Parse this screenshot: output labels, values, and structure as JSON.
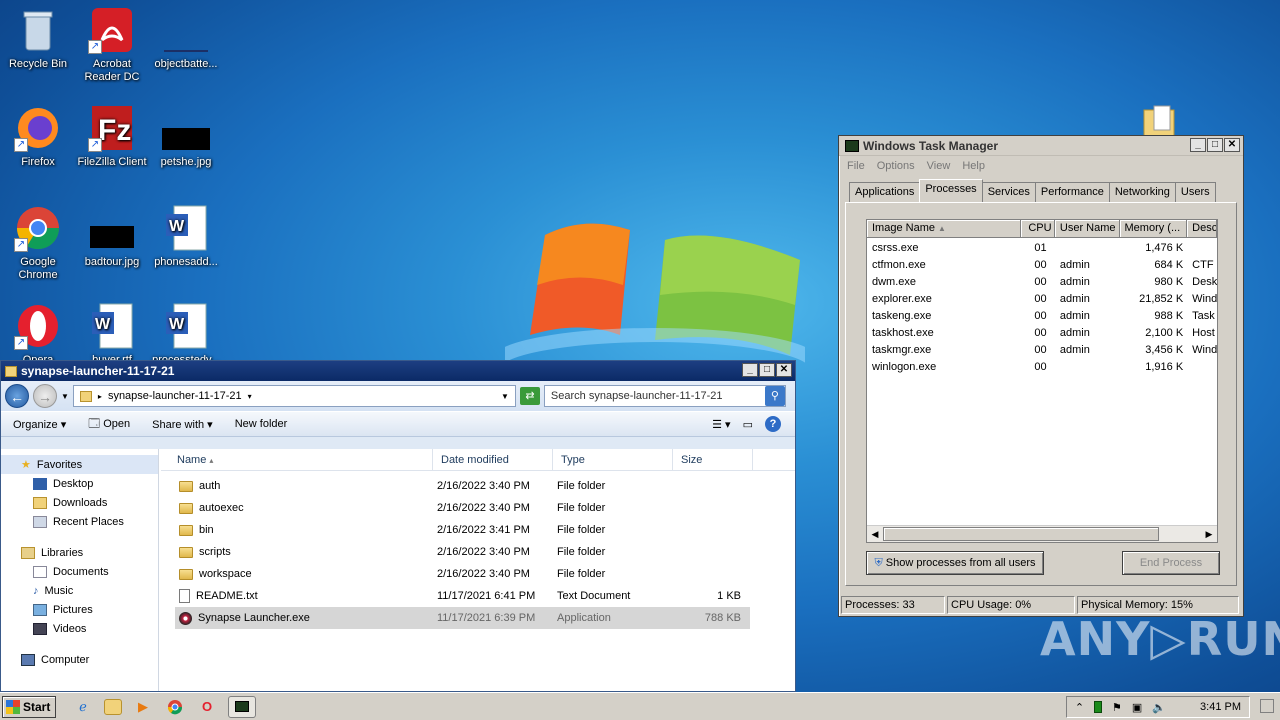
{
  "desktop": {
    "icons": [
      {
        "label": "Recycle Bin"
      },
      {
        "label": "Acrobat Reader DC"
      },
      {
        "label": "objectbatte..."
      },
      {
        "label": "Firefox"
      },
      {
        "label": "FileZilla Client"
      },
      {
        "label": "petshe.jpg"
      },
      {
        "label": "Google Chrome"
      },
      {
        "label": "badtour.jpg"
      },
      {
        "label": "phonesadd..."
      },
      {
        "label": "Opera"
      },
      {
        "label": "buyer.rtf"
      },
      {
        "label": "processtedy..."
      }
    ]
  },
  "explorer": {
    "title": "synapse-launcher-11-17-21",
    "address": "synapse-launcher-11-17-21",
    "search_placeholder": "Search synapse-launcher-11-17-21",
    "toolbar": {
      "organize": "Organize",
      "open": "Open",
      "share_with": "Share with",
      "new_folder": "New folder"
    },
    "nav": {
      "favorites": "Favorites",
      "desktop": "Desktop",
      "downloads": "Downloads",
      "recent": "Recent Places",
      "libraries": "Libraries",
      "documents": "Documents",
      "music": "Music",
      "pictures": "Pictures",
      "videos": "Videos",
      "computer": "Computer"
    },
    "columns": {
      "name": "Name",
      "date": "Date modified",
      "type": "Type",
      "size": "Size"
    },
    "files": [
      {
        "name": "auth",
        "date": "2/16/2022 3:40 PM",
        "type": "File folder",
        "size": ""
      },
      {
        "name": "autoexec",
        "date": "2/16/2022 3:40 PM",
        "type": "File folder",
        "size": ""
      },
      {
        "name": "bin",
        "date": "2/16/2022 3:41 PM",
        "type": "File folder",
        "size": ""
      },
      {
        "name": "scripts",
        "date": "2/16/2022 3:40 PM",
        "type": "File folder",
        "size": ""
      },
      {
        "name": "workspace",
        "date": "2/16/2022 3:40 PM",
        "type": "File folder",
        "size": ""
      },
      {
        "name": "README.txt",
        "date": "11/17/2021 6:41 PM",
        "type": "Text Document",
        "size": "1 KB"
      },
      {
        "name": "Synapse Launcher.exe",
        "date": "11/17/2021 6:39 PM",
        "type": "Application",
        "size": "788 KB"
      }
    ]
  },
  "taskmgr": {
    "title": "Windows Task Manager",
    "menu": [
      "File",
      "Options",
      "View",
      "Help"
    ],
    "tabs": [
      "Applications",
      "Processes",
      "Services",
      "Performance",
      "Networking",
      "Users"
    ],
    "columns": {
      "image": "Image Name",
      "cpu": "CPU",
      "user": "User Name",
      "memory": "Memory (...",
      "desc": "Desc"
    },
    "processes": [
      {
        "image": "csrss.exe",
        "cpu": "01",
        "user": "",
        "memory": "1,476 K",
        "desc": ""
      },
      {
        "image": "ctfmon.exe",
        "cpu": "00",
        "user": "admin",
        "memory": "684 K",
        "desc": "CTF L"
      },
      {
        "image": "dwm.exe",
        "cpu": "00",
        "user": "admin",
        "memory": "980 K",
        "desc": "Desk"
      },
      {
        "image": "explorer.exe",
        "cpu": "00",
        "user": "admin",
        "memory": "21,852 K",
        "desc": "Wind"
      },
      {
        "image": "taskeng.exe",
        "cpu": "00",
        "user": "admin",
        "memory": "988 K",
        "desc": "Task"
      },
      {
        "image": "taskhost.exe",
        "cpu": "00",
        "user": "admin",
        "memory": "2,100 K",
        "desc": "Host"
      },
      {
        "image": "taskmgr.exe",
        "cpu": "00",
        "user": "admin",
        "memory": "3,456 K",
        "desc": "Wind"
      },
      {
        "image": "winlogon.exe",
        "cpu": "00",
        "user": "",
        "memory": "1,916 K",
        "desc": ""
      }
    ],
    "show_all_label": "Show processes from all users",
    "end_process_label": "End Process",
    "status": {
      "processes": "Processes: 33",
      "cpu": "CPU Usage: 0%",
      "memory": "Physical Memory: 15%"
    }
  },
  "taskbar": {
    "start_label": "Start",
    "clock": "3:41 PM"
  },
  "watermark": "ANY▷RUN"
}
